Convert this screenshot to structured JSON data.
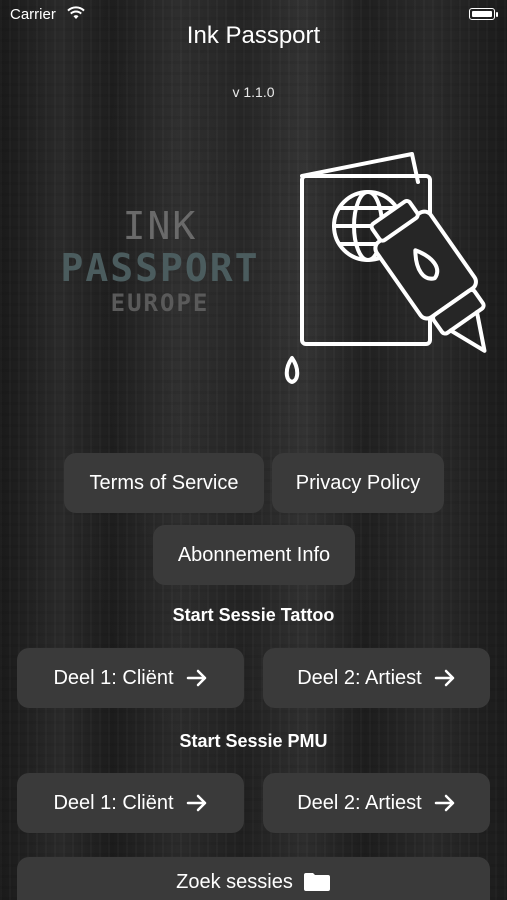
{
  "status_bar": {
    "carrier": "Carrier"
  },
  "app": {
    "title": "Ink Passport",
    "version": "v 1.1.0"
  },
  "logo": {
    "line1": "INK",
    "line2": "PASSPORT",
    "line3": "EUROPE"
  },
  "links": {
    "terms": "Terms of Service",
    "privacy": "Privacy Policy",
    "subscription": "Abonnement Info"
  },
  "tattoo": {
    "label": "Start Sessie Tattoo",
    "part1": "Deel 1: Cliënt",
    "part2": "Deel 2: Artiest"
  },
  "pmu": {
    "label": "Start Sessie PMU",
    "part1": "Deel 1: Cliënt",
    "part2": "Deel 2: Artiest"
  },
  "search": {
    "label": "Zoek sessies"
  },
  "icons": {
    "wifi": "wifi-icon",
    "battery": "battery-icon",
    "passport": "passport-tattoo-icon",
    "arrow": "arrow-right-icon",
    "folder": "folder-icon"
  }
}
